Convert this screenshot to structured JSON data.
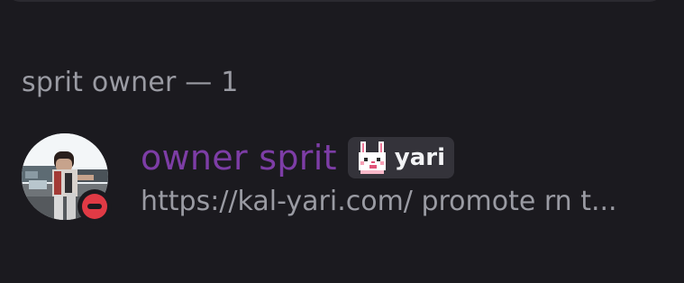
{
  "section": {
    "header": "sprit owner — 1"
  },
  "member": {
    "display_name": "owner sprit",
    "name_color": "#7d3da6",
    "clan_tag": "yari",
    "clan_badge_icon": "pink-bunny-icon",
    "status": "dnd",
    "status_color": "#e03a45",
    "custom_status": "https://kal-yari.com/ promote rn t..."
  }
}
